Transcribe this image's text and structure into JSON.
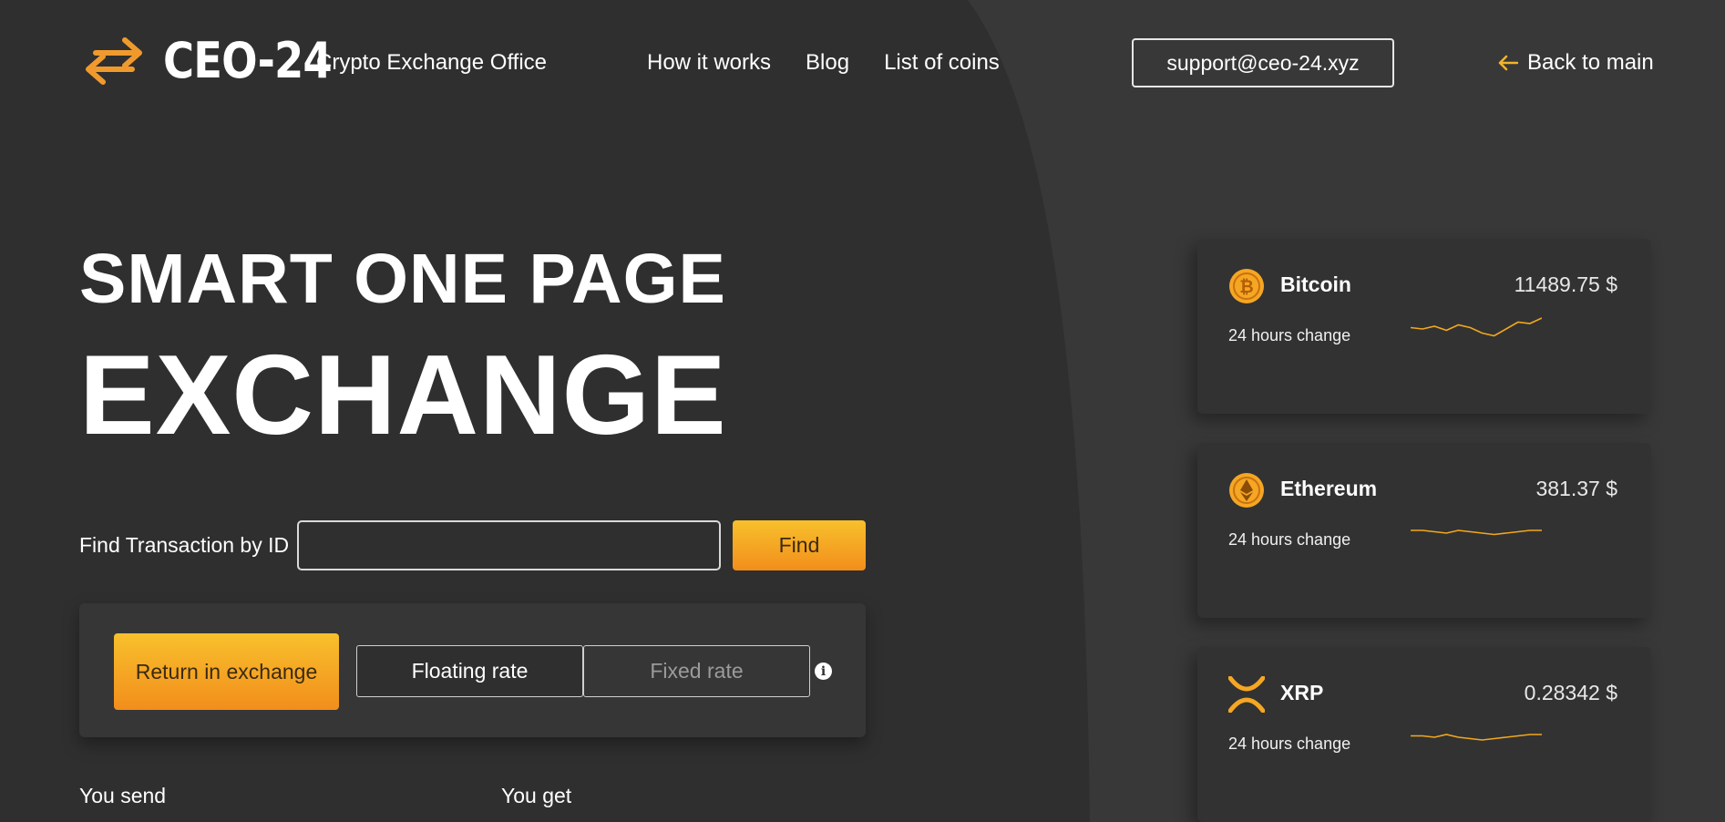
{
  "header": {
    "logo_text": "CEO-24",
    "tagline": "Crypto Exchange Office",
    "nav": [
      "How it works",
      "Blog",
      "List of coins"
    ],
    "support_email": "support@ceo-24.xyz",
    "back_label": "Back to main"
  },
  "hero": {
    "line1": "SMART ONE PAGE",
    "line2": "EXCHANGE"
  },
  "find": {
    "label": "Find Transaction by ID",
    "input_value": "",
    "button": "Find"
  },
  "exchange": {
    "return_button": "Return in exchange",
    "rate_tabs": [
      "Floating rate",
      "Fixed rate"
    ],
    "active_rate": "Floating rate",
    "info_icon": "info-icon",
    "send_label": "You send",
    "get_label": "You get"
  },
  "coins": [
    {
      "name": "Bitcoin",
      "price": "11489.75 $",
      "change_label": "24 hours change",
      "icon": "bitcoin-icon",
      "spark": [
        9,
        10,
        8,
        11,
        7,
        9,
        13,
        15,
        10,
        5,
        6,
        2
      ]
    },
    {
      "name": "Ethereum",
      "price": "381.37 $",
      "change_label": "24 hours change",
      "icon": "ethereum-icon",
      "spark": [
        8,
        8,
        9,
        10,
        8,
        9,
        10,
        11,
        10,
        9,
        8,
        8
      ]
    },
    {
      "name": "XRP",
      "price": "0.28342 $",
      "change_label": "24 hours change",
      "icon": "xrp-icon",
      "spark": [
        9,
        9,
        10,
        8,
        10,
        11,
        12,
        11,
        10,
        9,
        8,
        8
      ]
    }
  ],
  "colors": {
    "background": "#2f2f2f",
    "accent_top": "#f8c02c",
    "accent_bottom": "#f28e1c",
    "spark": "#f2a81c"
  }
}
